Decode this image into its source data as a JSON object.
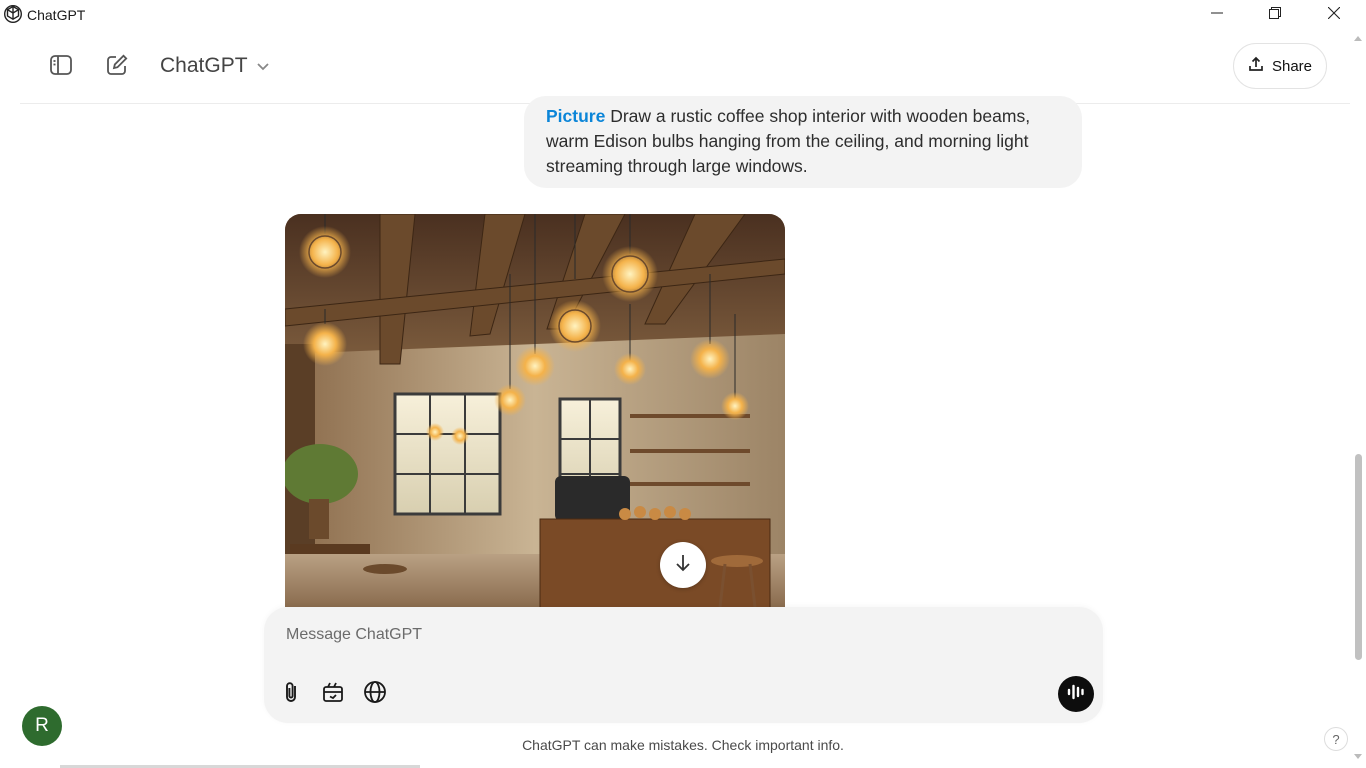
{
  "window": {
    "title": "ChatGPT",
    "controls": [
      "minimize-icon",
      "maximize-icon",
      "close-icon"
    ]
  },
  "header": {
    "model_name": "ChatGPT",
    "share_label": "Share"
  },
  "conversation": {
    "user_message": {
      "tag": "Picture",
      "text": " Draw a rustic coffee shop interior with wooden beams, warm Edison bulbs hanging from the ceiling, and morning light streaming through large windows."
    },
    "generated_image": {
      "subject": "rustic coffee shop interior with wooden beams, Edison bulbs and large windows"
    }
  },
  "composer": {
    "placeholder": "Message ChatGPT",
    "value": "",
    "icons": [
      "paperclip-icon",
      "tools-icon",
      "globe-icon",
      "voice-icon"
    ]
  },
  "footer": {
    "disclaimer": "ChatGPT can make mistakes. Check important info."
  },
  "user": {
    "avatar_initial": "R",
    "avatar_color": "#2e6b2e"
  },
  "help": {
    "label": "?"
  },
  "colors": {
    "accent_tag": "#0b85d8",
    "bubble_bg": "#f3f3f3",
    "composer_bg": "#f3f3f3"
  }
}
